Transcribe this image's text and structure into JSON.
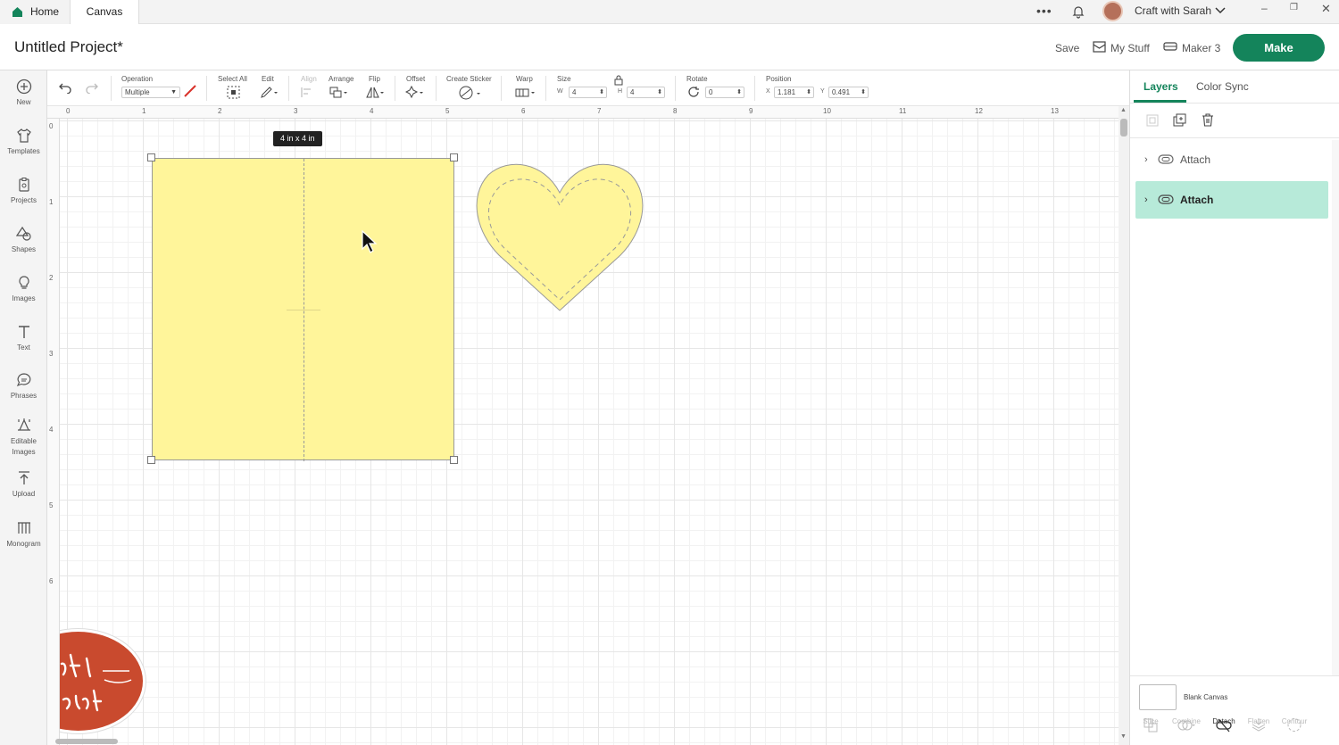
{
  "tabs": {
    "home": "Home",
    "canvas": "Canvas"
  },
  "topbar": {
    "user_name": "Craft with Sarah"
  },
  "header": {
    "project_title": "Untitled Project*",
    "save": "Save",
    "my_stuff": "My Stuff",
    "machine": "Maker 3",
    "make": "Make"
  },
  "leftbar": [
    {
      "label": "New",
      "icon": "plus-circle-icon"
    },
    {
      "label": "Templates",
      "icon": "shirt-icon"
    },
    {
      "label": "Projects",
      "icon": "projects-icon"
    },
    {
      "label": "Shapes",
      "icon": "shapes-icon"
    },
    {
      "label": "Images",
      "icon": "bulb-icon"
    },
    {
      "label": "Text",
      "icon": "text-icon"
    },
    {
      "label": "Phrases",
      "icon": "speech-bubble-icon"
    },
    {
      "label": "Editable Images",
      "icon": "editable-images-icon"
    },
    {
      "label": "Upload",
      "icon": "upload-icon"
    },
    {
      "label": "Monogram",
      "icon": "monogram-icon"
    }
  ],
  "toolbar": {
    "operation_label": "Operation",
    "operation_value": "Multiple",
    "select_all": "Select All",
    "edit": "Edit",
    "align": "Align",
    "arrange": "Arrange",
    "flip": "Flip",
    "offset": "Offset",
    "create_sticker": "Create Sticker",
    "warp": "Warp",
    "size": "Size",
    "w_label": "W",
    "w_value": "4",
    "h_label": "H",
    "h_value": "4",
    "rotate": "Rotate",
    "rotate_value": "0",
    "position": "Position",
    "x_label": "X",
    "x_value": "1.181",
    "y_label": "Y",
    "y_value": "0.491"
  },
  "ruler": {
    "top": [
      "0",
      "1",
      "2",
      "3",
      "4",
      "5",
      "6",
      "7",
      "8",
      "9",
      "10",
      "11",
      "12",
      "13"
    ],
    "left": [
      "0",
      "1",
      "2",
      "3",
      "4",
      "5",
      "6"
    ]
  },
  "canvas": {
    "size_tooltip": "4 in x 4 in",
    "fill_color": "#fff59a"
  },
  "rightpanel": {
    "tab_layers": "Layers",
    "tab_color_sync": "Color Sync",
    "layers": [
      {
        "label": "Attach",
        "selected": false
      },
      {
        "label": "Attach",
        "selected": true
      }
    ],
    "blank_canvas": "Blank Canvas",
    "footer": [
      "Slice",
      "Combine",
      "Detach",
      "Flatten",
      "Contour"
    ]
  },
  "colors": {
    "accent": "#14845b",
    "selected_layer": "#b7ead9"
  },
  "watermark": "Craft with Sarah"
}
